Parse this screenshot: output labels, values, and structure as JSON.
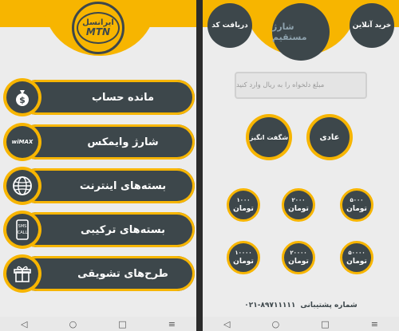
{
  "left": {
    "logo": {
      "top": "ایرانسل",
      "bottom": "MTN"
    },
    "menu": [
      {
        "label": "مانده حساب",
        "icon": "money-bag-icon",
        "glyph": "$"
      },
      {
        "label": "شارژ وایمکس",
        "icon": "wimax-icon",
        "glyph": "wiMAX"
      },
      {
        "label": "بسته‌های اینترنت",
        "icon": "globe-icon",
        "glyph": "🌐"
      },
      {
        "label": "بسته‌های ترکیبی",
        "icon": "sms-call-phone-icon",
        "glyph": "SMS"
      },
      {
        "label": "طرح‌های تشویقی",
        "icon": "gift-box-icon",
        "glyph": "🎁"
      }
    ]
  },
  "right": {
    "top_left_button": "دریافت کد",
    "top_center_title": "شارژ مستقیم",
    "top_right_button": "خرید آنلاین",
    "amount_placeholder": "مبلغ دلخواه را به ریال وارد کنید",
    "plan_button_amazing": "شگفت انگیز",
    "plan_button_normal": "عادی",
    "amounts": [
      {
        "value": "۱۰۰۰",
        "currency": "تومان"
      },
      {
        "value": "۲۰۰۰",
        "currency": "تومان"
      },
      {
        "value": "۵۰۰۰",
        "currency": "تومان"
      },
      {
        "value": "۱۰۰۰۰",
        "currency": "تومان"
      },
      {
        "value": "۲۰۰۰۰",
        "currency": "تومان"
      },
      {
        "value": "۵۰۰۰۰",
        "currency": "تومان"
      }
    ],
    "support_label": "شماره پشتیبانی",
    "support_number": "۰۲۱-۸۹۷۱۱۱۱۱"
  },
  "navbar": {
    "back": "◁",
    "home": "○",
    "recent": "□",
    "menu": "≡"
  },
  "colors": {
    "accent": "#f7b500",
    "dark": "#3d474b",
    "background": "#ececec"
  }
}
